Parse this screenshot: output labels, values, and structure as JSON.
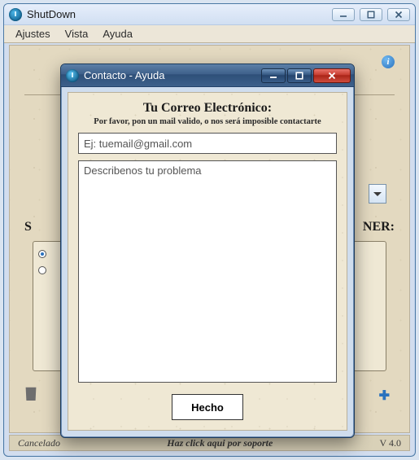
{
  "main": {
    "title": "ShutDown",
    "menu": {
      "ajustes": "Ajustes",
      "vista": "Vista",
      "ayuda": "Ayuda"
    },
    "section_right": "NER:",
    "section_left": "S",
    "status": {
      "left": "Cancelado",
      "center": "Haz click aqui por soporte",
      "right": "V 4.0"
    }
  },
  "dialog": {
    "title": "Contacto - Ayuda",
    "heading": "Tu Correo Electrónico:",
    "sub": "Por favor, pon un mail valido, o nos será imposible contactarte",
    "email_placeholder": "Ej: tuemail@gmail.com",
    "problem_placeholder": "Describenos tu problema",
    "done": "Hecho"
  }
}
